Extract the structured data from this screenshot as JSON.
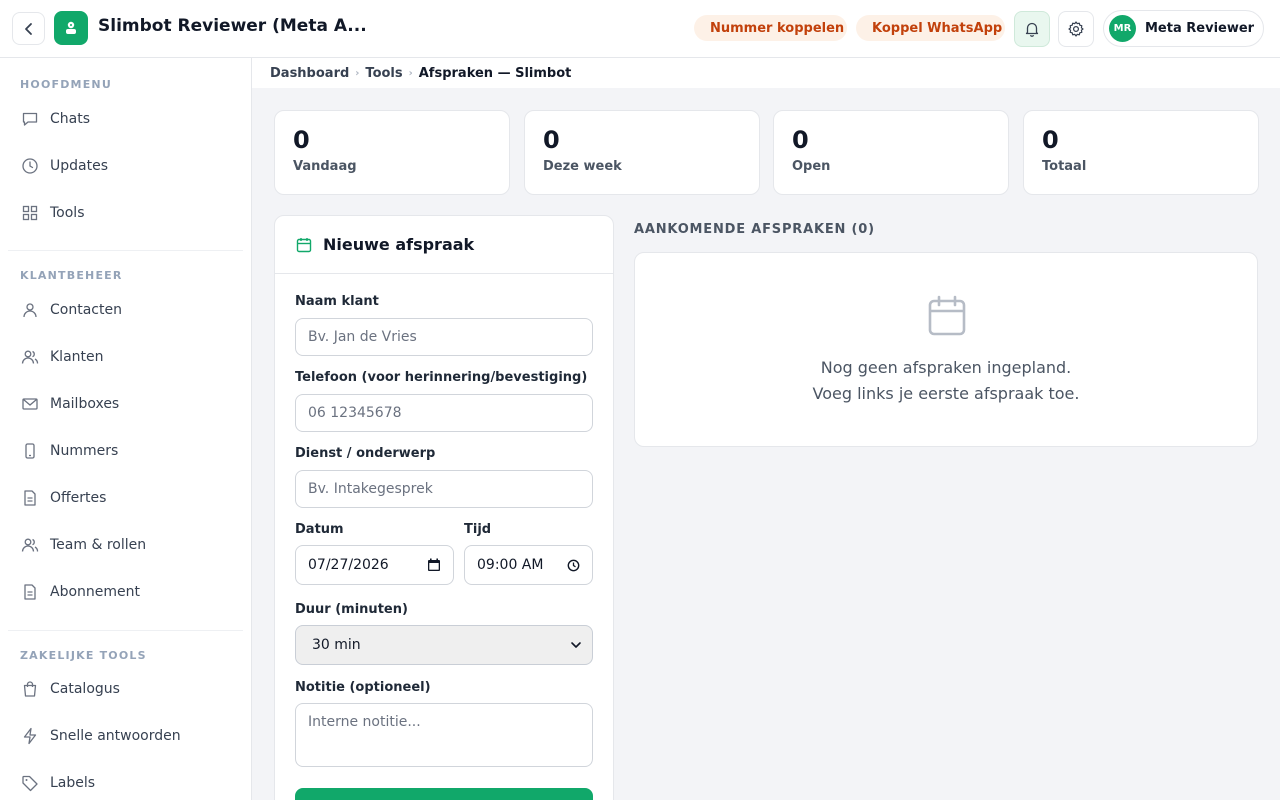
{
  "header": {
    "back_label": "Terug",
    "app_title": "Slimbot Reviewer (Meta A...",
    "pill_number": "Nummer koppelen",
    "pill_whatsapp": "Koppel WhatsApp",
    "user_initials": "MR",
    "user_name": "Meta Reviewer"
  },
  "sidebar": {
    "sections": [
      {
        "title": "HOOFDMENU",
        "items": [
          {
            "label": "Chats",
            "icon": "chat-icon"
          },
          {
            "label": "Updates",
            "icon": "clock-icon"
          },
          {
            "label": "Tools",
            "icon": "grid-icon"
          }
        ]
      },
      {
        "title": "KLANTBEHEER",
        "items": [
          {
            "label": "Contacten",
            "icon": "user-icon"
          },
          {
            "label": "Klanten",
            "icon": "users-icon"
          },
          {
            "label": "Mailboxes",
            "icon": "mail-icon"
          },
          {
            "label": "Nummers",
            "icon": "phone-icon"
          },
          {
            "label": "Offertes",
            "icon": "document-icon"
          },
          {
            "label": "Team & rollen",
            "icon": "users-icon"
          },
          {
            "label": "Abonnement",
            "icon": "document-icon"
          }
        ]
      },
      {
        "title": "ZAKELIJKE TOOLS",
        "items": [
          {
            "label": "Catalogus",
            "icon": "bag-icon"
          },
          {
            "label": "Snelle antwoorden",
            "icon": "bolt-icon"
          },
          {
            "label": "Labels",
            "icon": "tag-icon"
          }
        ]
      }
    ]
  },
  "breadcrumb": {
    "items": [
      "Dashboard",
      "Tools",
      "Afspraken — Slimbot"
    ]
  },
  "stats": [
    {
      "value": "0",
      "label": "Vandaag"
    },
    {
      "value": "0",
      "label": "Deze week"
    },
    {
      "value": "0",
      "label": "Open"
    },
    {
      "value": "0",
      "label": "Totaal"
    }
  ],
  "form": {
    "title": "Nieuwe afspraak",
    "name_label": "Naam klant",
    "name_placeholder": "Bv. Jan de Vries",
    "phone_label": "Telefoon (voor herinnering/bevestiging)",
    "phone_placeholder": "06 12345678",
    "service_label": "Dienst / onderwerp",
    "service_placeholder": "Bv. Intakegesprek",
    "date_label": "Datum",
    "date_value": "07/27/2026",
    "time_label": "Tijd",
    "time_value": "09:00 AM",
    "duration_label": "Duur (minuten)",
    "duration_value": "30 min",
    "note_label": "Notitie (optioneel)",
    "note_placeholder": "Interne notitie..."
  },
  "upcoming": {
    "title": "AANKOMENDE AFSPRAKEN (0)",
    "empty_line1": "Nog geen afspraken ingepland.",
    "empty_line2": "Voeg links je eerste afspraak toe."
  },
  "colors": {
    "brand_green": "#11a86a",
    "warning_orange": "#f97316",
    "warning_text": "#c2410c"
  }
}
